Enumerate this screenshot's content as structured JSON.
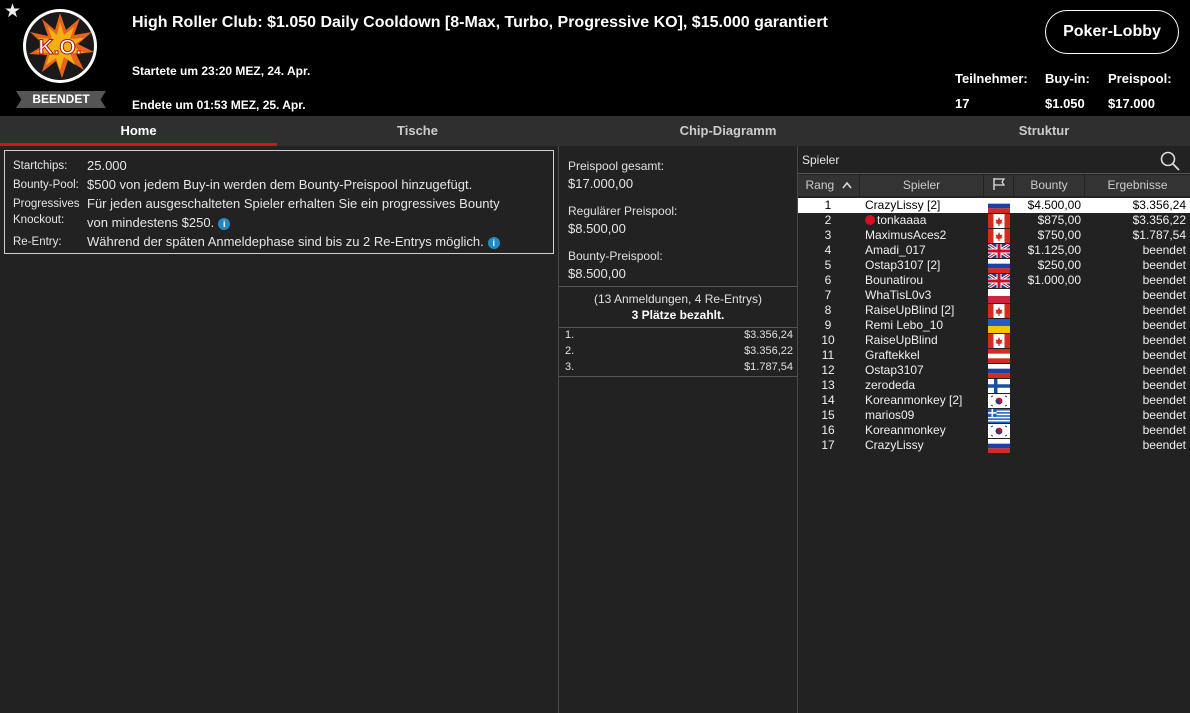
{
  "header": {
    "favorite_icon": "star-icon",
    "logo_text": "K.O.",
    "status": "BEENDET",
    "title": "High Roller Club: $1.050 Daily Cooldown [8-Max, Turbo, Progressive KO], $15.000 garantiert",
    "started": "Startete um 23:20 MEZ, 24. Apr.",
    "ended": "Endete um 01:53 MEZ, 25. Apr.",
    "lobby_button": "Poker-Lobby",
    "stats": {
      "players_label": "Teilnehmer:",
      "players_value": "17",
      "buyin_label": "Buy-in:",
      "buyin_value": "$1.050",
      "prizepool_label": "Preispool:",
      "prizepool_value": "$17.000"
    }
  },
  "tabs": [
    {
      "label": "Home",
      "active": true
    },
    {
      "label": "Tische",
      "active": false
    },
    {
      "label": "Chip-Diagramm",
      "active": false
    },
    {
      "label": "Struktur",
      "active": false
    }
  ],
  "info": {
    "startchips_label": "Startchips:",
    "startchips_value": "25.000",
    "bountypool_label": "Bounty-Pool:",
    "bountypool_value": "$500 von jedem Buy-in werden dem Bounty-Preispool hinzugefügt.",
    "pko_label_1": "Progressives",
    "pko_label_2": "Knockout:",
    "pko_value_1": "Für jeden ausgeschalteten Spieler erhalten Sie ein progressives Bounty",
    "pko_value_2": "von mindestens $250.",
    "reentry_label": "Re-Entry:",
    "reentry_value": "Während der späten Anmeldephase sind bis zu 2 Re-Entrys möglich.",
    "info_icon_glyph": "i"
  },
  "pools": {
    "total_label": "Preispool gesamt:",
    "total_value": "$17.000,00",
    "regular_label": "Regulärer Preispool:",
    "regular_value": "$8.500,00",
    "bounty_label": "Bounty-Preispool:",
    "bounty_value": "$8.500,00",
    "entries": "(13 Anmeldungen, 4 Re-Entrys)",
    "paid": "3 Plätze bezahlt.",
    "payouts": [
      {
        "place": "1.",
        "amount": "$3.356,24"
      },
      {
        "place": "2.",
        "amount": "$3.356,22"
      },
      {
        "place": "3.",
        "amount": "$1.787,54"
      }
    ]
  },
  "players": {
    "search_placeholder": "Spieler",
    "columns": {
      "rank": "Rang",
      "player": "Spieler",
      "bounty": "Bounty",
      "result": "Ergebnisse"
    },
    "rows": [
      {
        "rank": "1",
        "name": "CrazyLissy [2]",
        "flag": "ru",
        "bounty": "$4.500,00",
        "result": "$3.356,24",
        "selected": true
      },
      {
        "rank": "2",
        "name": "tonkaaaa",
        "flag": "ca",
        "bounty": "$875,00",
        "result": "$3.356,22",
        "pro": true
      },
      {
        "rank": "3",
        "name": "MaximusAces2",
        "flag": "ca",
        "bounty": "$750,00",
        "result": "$1.787,54"
      },
      {
        "rank": "4",
        "name": "Amadi_017",
        "flag": "gb",
        "bounty": "$1.125,00",
        "result": "beendet"
      },
      {
        "rank": "5",
        "name": "Ostap3107 [2]",
        "flag": "ru",
        "bounty": "$250,00",
        "result": "beendet"
      },
      {
        "rank": "6",
        "name": "Bounatirou",
        "flag": "gb",
        "bounty": "$1.000,00",
        "result": "beendet"
      },
      {
        "rank": "7",
        "name": "WhaTisL0v3",
        "flag": "pl",
        "bounty": "",
        "result": "beendet"
      },
      {
        "rank": "8",
        "name": "RaiseUpBlind [2]",
        "flag": "ca",
        "bounty": "",
        "result": "beendet"
      },
      {
        "rank": "9",
        "name": "Remi Lebo_10",
        "flag": "ua",
        "bounty": "",
        "result": "beendet"
      },
      {
        "rank": "10",
        "name": "RaiseUpBlind",
        "flag": "ca",
        "bounty": "",
        "result": "beendet"
      },
      {
        "rank": "11",
        "name": "Graftekkel",
        "flag": "at",
        "bounty": "",
        "result": "beendet"
      },
      {
        "rank": "12",
        "name": "Ostap3107",
        "flag": "ru",
        "bounty": "",
        "result": "beendet"
      },
      {
        "rank": "13",
        "name": "zerodeda",
        "flag": "fi",
        "bounty": "",
        "result": "beendet"
      },
      {
        "rank": "14",
        "name": "Koreanmonkey [2]",
        "flag": "kr",
        "bounty": "",
        "result": "beendet"
      },
      {
        "rank": "15",
        "name": "marios09",
        "flag": "gr",
        "bounty": "",
        "result": "beendet"
      },
      {
        "rank": "16",
        "name": "Koreanmonkey",
        "flag": "kr",
        "bounty": "",
        "result": "beendet"
      },
      {
        "rank": "17",
        "name": "CrazyLissy",
        "flag": "ru",
        "bounty": "",
        "result": "beendet"
      }
    ]
  },
  "colors": {
    "accent_red": "#d4131f",
    "info_blue": "#2389c6"
  }
}
